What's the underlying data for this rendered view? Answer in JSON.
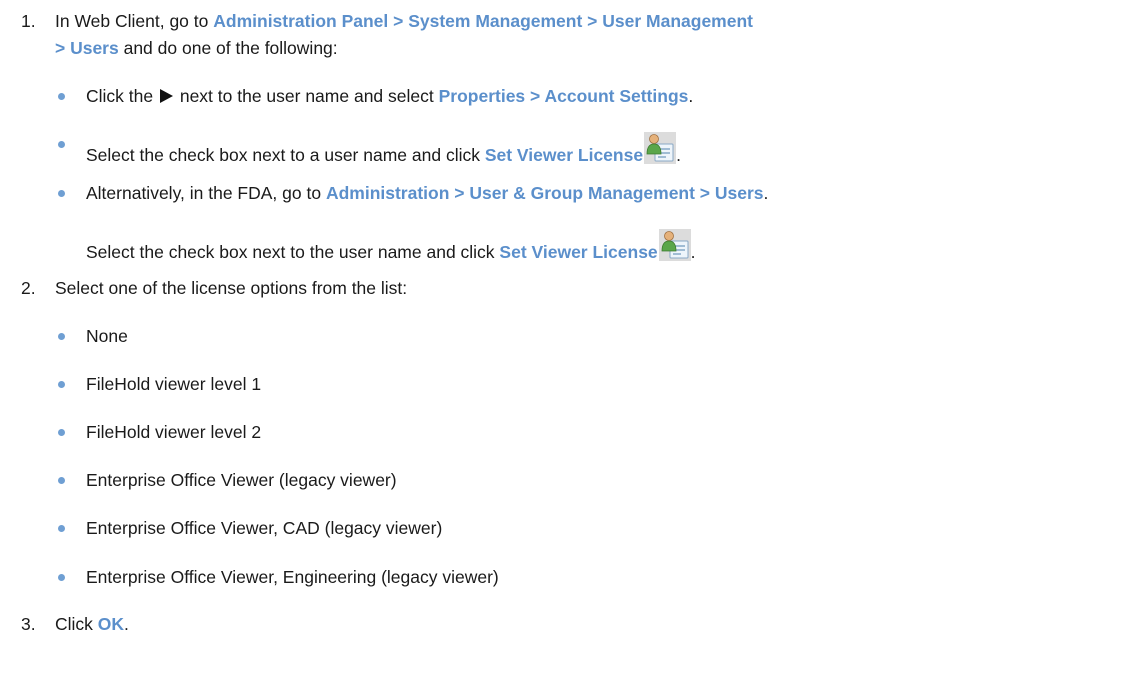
{
  "step1": {
    "number": "1.",
    "part1": "In Web Client, go to ",
    "path": "Administration Panel > System Management > User Management",
    "path_cont": "> Users",
    "part2": " and do one of the following:",
    "bullets": {
      "b1": {
        "pre": "Click the ",
        "mid": " next to the user name and select ",
        "link": "Properties > Account Settings",
        "post": "."
      },
      "b2": {
        "pre": "Select the check box next to a user name and click ",
        "link": "Set Viewer License",
        "post": "."
      },
      "b3": {
        "pre": "Alternatively, in the FDA, go to ",
        "link": "Administration > User & Group Management > Users",
        "post": "."
      },
      "b3_cont": {
        "pre": "Select the check box next to the user name and click ",
        "link": "Set Viewer License",
        "post": "."
      }
    }
  },
  "step2": {
    "number": "2.",
    "text": "Select one of the license options from the list:",
    "options": [
      "None",
      "FileHold viewer level 1",
      "FileHold viewer level 2",
      "Enterprise Office Viewer (legacy viewer)",
      "Enterprise Office Viewer, CAD (legacy viewer)",
      "Enterprise Office Viewer, Engineering (legacy viewer)"
    ]
  },
  "step3": {
    "number": "3.",
    "pre": "Click ",
    "link": "OK",
    "post": "."
  },
  "colors": {
    "accent": "#5b8fcb",
    "bullet": "#6f9fd3",
    "text": "#1a1a1a"
  },
  "icons": {
    "triangle": "play-triangle-icon",
    "license": "set-viewer-license-icon"
  }
}
